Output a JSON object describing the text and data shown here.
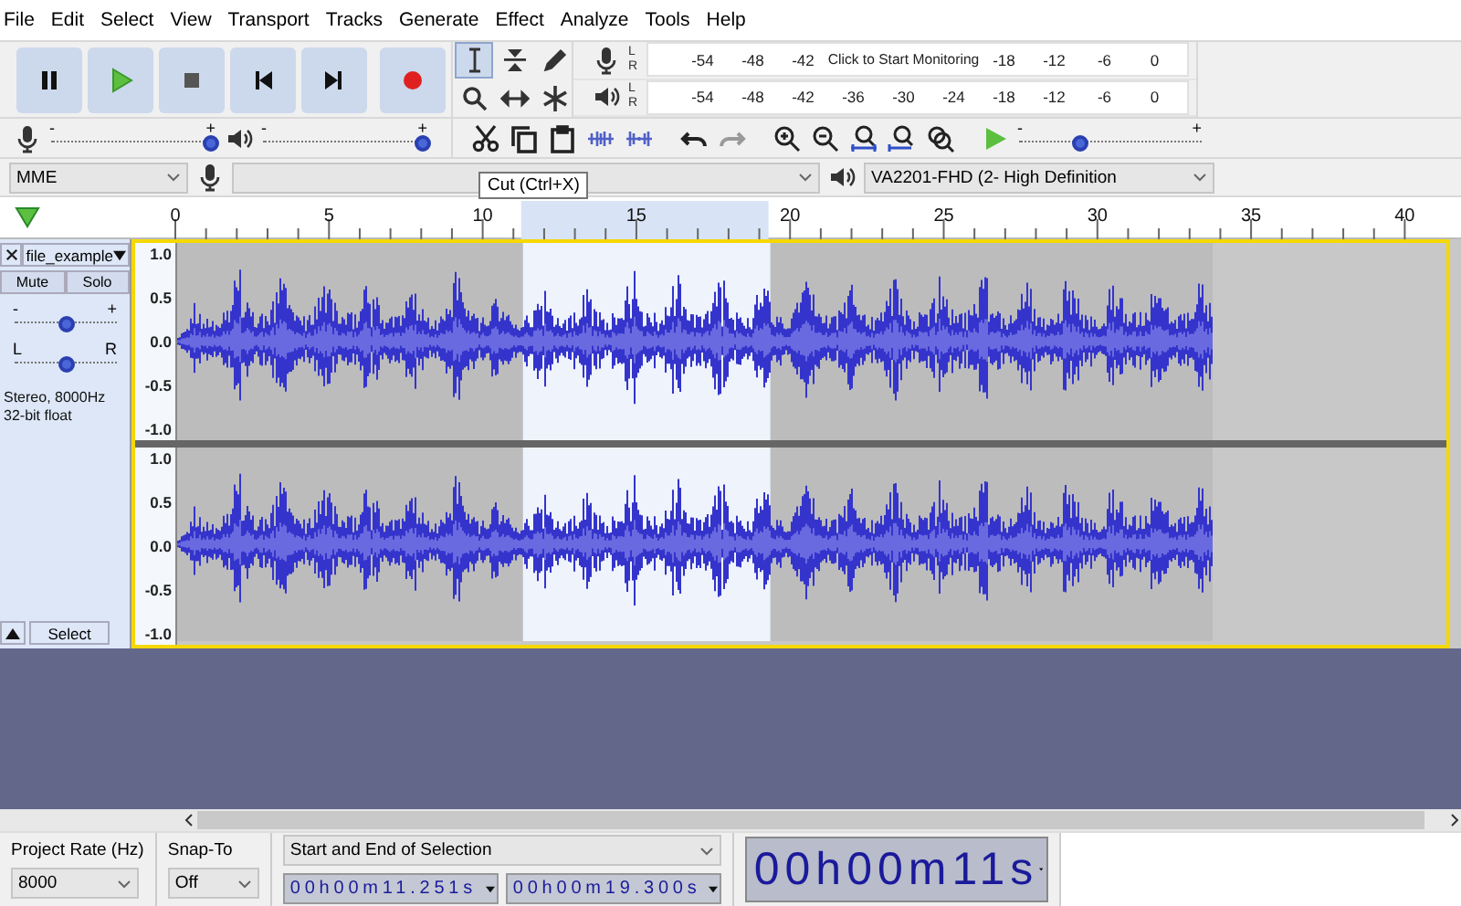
{
  "menu": [
    "File",
    "Edit",
    "Select",
    "View",
    "Transport",
    "Tracks",
    "Generate",
    "Effect",
    "Analyze",
    "Tools",
    "Help"
  ],
  "tools": [
    {
      "selected": true
    },
    {
      "selected": false
    },
    {
      "selected": false
    },
    {
      "selected": false
    },
    {
      "selected": false
    },
    {
      "selected": false
    }
  ],
  "meters": {
    "record": {
      "channels": [
        "L",
        "R"
      ],
      "left_labels": [
        "-54",
        "-48",
        "-42"
      ],
      "message": "Click to Start Monitoring",
      "right_labels": [
        "-18",
        "-12",
        "-6",
        "0"
      ]
    },
    "playback": {
      "channels": [
        "L",
        "R"
      ],
      "labels": [
        "-54",
        "-48",
        "-42",
        "-36",
        "-30",
        "-24",
        "-18",
        "-12",
        "-6",
        "0"
      ]
    }
  },
  "mixer": {
    "recording": {
      "min": "-",
      "max": "+",
      "level": 0.97
    },
    "playback": {
      "min": "-",
      "max": "+",
      "level": 0.97
    }
  },
  "play_at_speed": {
    "min": "-",
    "max": "+",
    "level": 0.33
  },
  "devices": {
    "host": "MME",
    "output": "VA2201-FHD (2- High Definition"
  },
  "tooltip": "Cut (Ctrl+X)",
  "ruler": {
    "labels": [
      "0",
      "5",
      "10",
      "15",
      "20",
      "25",
      "30",
      "35",
      "40"
    ]
  },
  "track": {
    "name": "file_example",
    "mute": "Mute",
    "solo": "Solo",
    "gain": {
      "min": "-",
      "max": "+",
      "level": 0.5
    },
    "pan": {
      "min": "L",
      "max": "R",
      "level": 0.5
    },
    "info": [
      "Stereo, 8000Hz",
      "32-bit float"
    ],
    "select": "Select",
    "channels": [
      {
        "scale": [
          "1.0",
          "0.5",
          "0.0",
          "-0.5",
          "-1.0"
        ]
      },
      {
        "scale": [
          "1.0",
          "0.5",
          "0.0",
          "-0.5",
          "-1.0"
        ]
      }
    ]
  },
  "selection_toolbar": {
    "project_rate_label": "Project Rate (Hz)",
    "project_rate": "8000",
    "snap_label": "Snap-To",
    "snap": "Off",
    "selection_mode": "Start and End of Selection",
    "start": "00h00m11.251s",
    "end": "00h00m19.300s"
  },
  "time_display": "00h00m11s"
}
